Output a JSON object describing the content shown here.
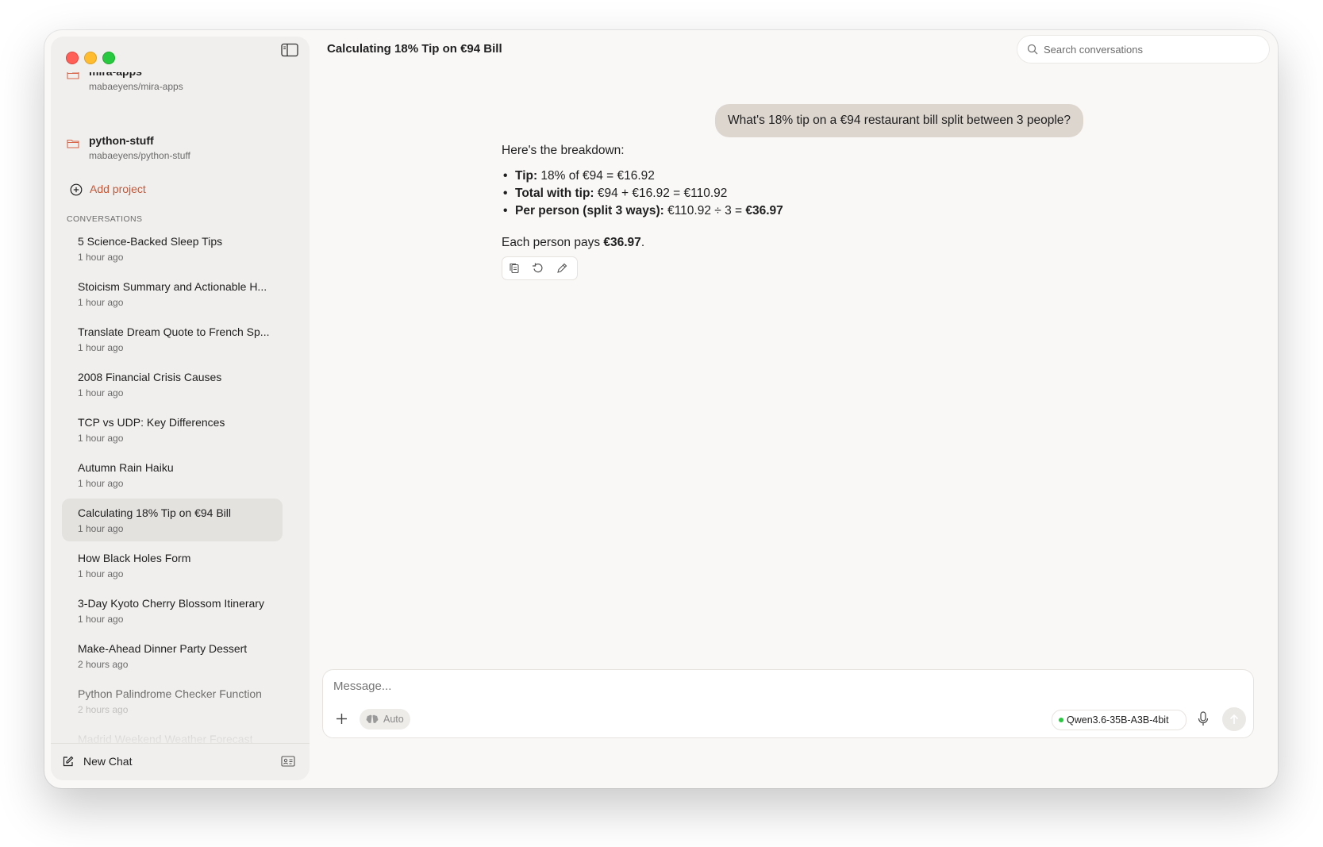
{
  "window": {
    "title": "Calculating 18% Tip on €94 Bill"
  },
  "search": {
    "placeholder": "Search conversations"
  },
  "sidebar": {
    "projects": [
      {
        "name": "mira-apps",
        "repo": "mabaeyens/mira-apps"
      },
      {
        "name": "python-stuff",
        "repo": "mabaeyens/python-stuff"
      }
    ],
    "add_project_label": "Add project",
    "conversations_label": "CONVERSATIONS",
    "conversations": [
      {
        "title": "5 Science-Backed Sleep Tips",
        "time": "1 hour ago"
      },
      {
        "title": "Stoicism Summary and Actionable H...",
        "time": "1 hour ago"
      },
      {
        "title": "Translate Dream Quote to French Sp...",
        "time": "1 hour ago"
      },
      {
        "title": "2008 Financial Crisis Causes",
        "time": "1 hour ago"
      },
      {
        "title": "TCP vs UDP: Key Differences",
        "time": "1 hour ago"
      },
      {
        "title": "Autumn Rain Haiku",
        "time": "1 hour ago"
      },
      {
        "title": "Calculating 18% Tip on €94 Bill",
        "time": "1 hour ago",
        "active": true
      },
      {
        "title": "How Black Holes Form",
        "time": "1 hour ago"
      },
      {
        "title": "3-Day Kyoto Cherry Blossom Itinerary",
        "time": "1 hour ago"
      },
      {
        "title": "Make-Ahead Dinner Party Dessert",
        "time": "2 hours ago"
      },
      {
        "title": "Python Palindrome Checker Function",
        "time": "2 hours ago"
      },
      {
        "title": "Madrid Weekend Weather Forecast",
        "time": ""
      }
    ],
    "new_chat_label": "New Chat"
  },
  "chat": {
    "user_message": "What's 18% tip on a €94 restaurant bill split between 3 people?",
    "assistant": {
      "intro": "Here's the breakdown:",
      "bullets": [
        {
          "bold": "Tip:",
          "text": " 18% of €94 = €16.92",
          "tail_bold": ""
        },
        {
          "bold": "Total with tip:",
          "text": " €94 + €16.92 = €110.92",
          "tail_bold": ""
        },
        {
          "bold": "Per person (split 3 ways):",
          "text": " €110.92 ÷ 3 = ",
          "tail_bold": "€36.97"
        }
      ],
      "outro_prefix": "Each person pays ",
      "outro_bold": "€36.97",
      "outro_suffix": "."
    },
    "actions": [
      "copy-icon",
      "regenerate-icon",
      "edit-icon"
    ]
  },
  "composer": {
    "placeholder": "Message...",
    "auto_label": "Auto",
    "model_label": "Qwen3.6-35B-A3B-4bit",
    "model_status_color": "#28c840"
  },
  "colors": {
    "accent": "#c0593a",
    "user_bubble": "#dcd6cf",
    "sidebar_bg": "#f1efed",
    "active_item": "#e4e2df"
  }
}
